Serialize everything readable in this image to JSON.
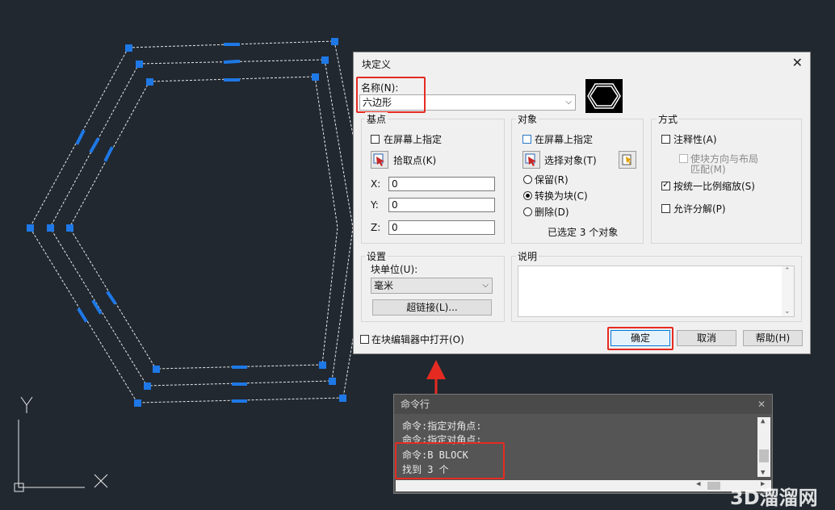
{
  "dialog": {
    "title": "块定义",
    "name_label": "名称(N):",
    "name_value": "六边形",
    "basepoint": {
      "title": "基点",
      "onscreen": "在屏幕上指定",
      "pick": "拾取点(K)",
      "x_label": "X:",
      "x": "0",
      "y_label": "Y:",
      "y": "0",
      "z_label": "Z:",
      "z": "0"
    },
    "objects": {
      "title": "对象",
      "onscreen": "在屏幕上指定",
      "select": "选择对象(T)",
      "retain": "保留(R)",
      "convert": "转换为块(C)",
      "delete": "删除(D)",
      "selected_status": "已选定 3 个对象"
    },
    "behavior": {
      "title": "方式",
      "annotative": "注释性(A)",
      "match_orientation_1": "使块方向与布局",
      "match_orientation_2": "匹配(M)",
      "scale_uniform": "按统一比例缩放(S)",
      "allow_explode": "允许分解(P)"
    },
    "settings": {
      "title": "设置",
      "unit_label": "块单位(U):",
      "unit_value": "毫米",
      "hyperlink": "超链接(L)..."
    },
    "description": {
      "title": "说明"
    },
    "open_in_editor": "在块编辑器中打开(O)",
    "ok": "确定",
    "cancel": "取消",
    "help": "帮助(H)"
  },
  "command": {
    "title": "命令行",
    "lines": [
      "命令:指定对角点:",
      "命令:指定对角点:",
      "命令:B BLOCK",
      "找到 3 个"
    ]
  },
  "watermark": "3D溜溜网",
  "colors": {
    "background": "#212830",
    "grip": "#1e78e6",
    "highlight": "#e52b21"
  }
}
